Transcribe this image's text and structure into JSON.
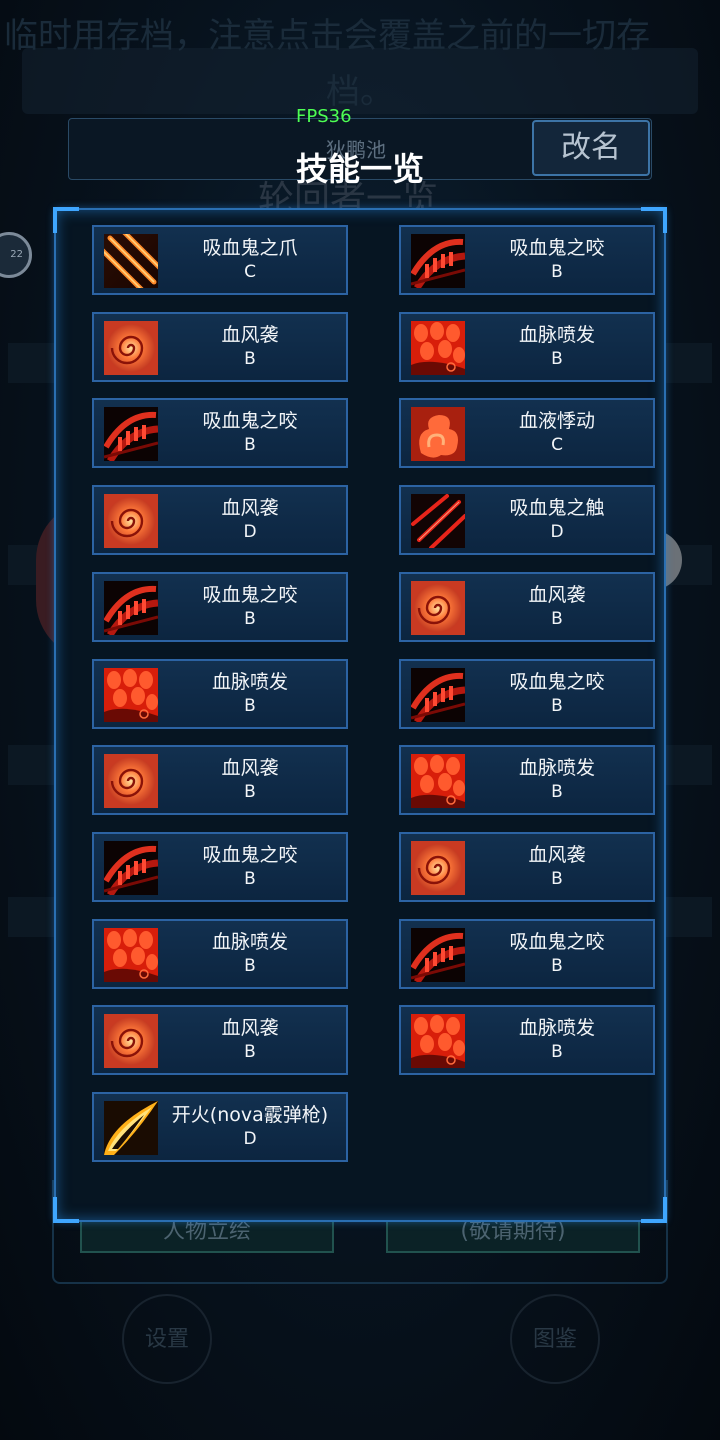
{
  "background": {
    "notice_line1": "临时用存档，注意点击会覆盖之前的一切存",
    "notice_line2": "档。",
    "ghost_title": "轮回者一览",
    "left_badge": "22",
    "bottom_left_button": "人物立绘",
    "bottom_right_button": "(敬请期待)",
    "settings_button": "设置",
    "codex_button": "图鉴"
  },
  "header": {
    "fps": "FPS36",
    "player_name": "狄鹏池",
    "rename_button": "改名",
    "title": "技能一览"
  },
  "colors": {
    "card_border": "#2c63a3",
    "panel_border": "#2a6fb2",
    "fps_green": "#4dff53"
  },
  "skills": [
    {
      "name": "吸血鬼之爪",
      "grade": "C",
      "icon": "claw-icon"
    },
    {
      "name": "吸血鬼之咬",
      "grade": "B",
      "icon": "bite-icon"
    },
    {
      "name": "血风袭",
      "grade": "B",
      "icon": "blood-swirl-icon"
    },
    {
      "name": "血脉喷发",
      "grade": "B",
      "icon": "blood-burst-icon"
    },
    {
      "name": "吸血鬼之咬",
      "grade": "B",
      "icon": "bite-icon"
    },
    {
      "name": "血液悸动",
      "grade": "C",
      "icon": "blood-pulse-icon"
    },
    {
      "name": "血风袭",
      "grade": "D",
      "icon": "blood-swirl-icon"
    },
    {
      "name": "吸血鬼之触",
      "grade": "D",
      "icon": "touch-icon"
    },
    {
      "name": "吸血鬼之咬",
      "grade": "B",
      "icon": "bite-icon"
    },
    {
      "name": "血风袭",
      "grade": "B",
      "icon": "blood-swirl-icon"
    },
    {
      "name": "血脉喷发",
      "grade": "B",
      "icon": "blood-burst-icon"
    },
    {
      "name": "吸血鬼之咬",
      "grade": "B",
      "icon": "bite-icon"
    },
    {
      "name": "血风袭",
      "grade": "B",
      "icon": "blood-swirl-icon"
    },
    {
      "name": "血脉喷发",
      "grade": "B",
      "icon": "blood-burst-icon"
    },
    {
      "name": "吸血鬼之咬",
      "grade": "B",
      "icon": "bite-icon"
    },
    {
      "name": "血风袭",
      "grade": "B",
      "icon": "blood-swirl-icon"
    },
    {
      "name": "血脉喷发",
      "grade": "B",
      "icon": "blood-burst-icon"
    },
    {
      "name": "吸血鬼之咬",
      "grade": "B",
      "icon": "bite-icon"
    },
    {
      "name": "血风袭",
      "grade": "B",
      "icon": "blood-swirl-icon"
    },
    {
      "name": "血脉喷发",
      "grade": "B",
      "icon": "blood-burst-icon"
    },
    {
      "name": "开火(nova霰弹枪)",
      "grade": "D",
      "icon": "fire-shot-icon"
    }
  ]
}
